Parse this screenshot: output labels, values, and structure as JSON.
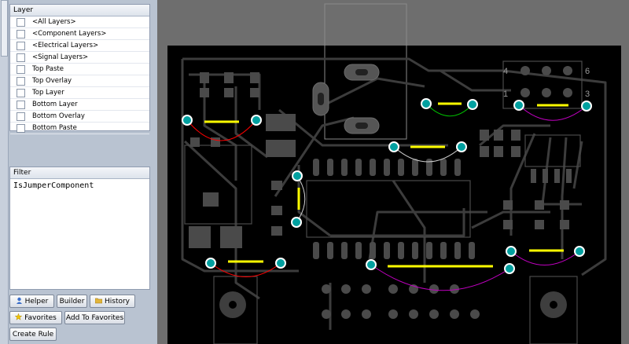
{
  "layer_panel": {
    "title": "Layer",
    "items": [
      {
        "label": "<All Layers>"
      },
      {
        "label": "<Component Layers>"
      },
      {
        "label": "<Electrical Layers>"
      },
      {
        "label": "<Signal Layers>"
      },
      {
        "label": "Top Paste"
      },
      {
        "label": "Top Overlay"
      },
      {
        "label": "Top Layer"
      },
      {
        "label": "Bottom Layer"
      },
      {
        "label": "Bottom Overlay"
      },
      {
        "label": "Bottom Paste"
      }
    ]
  },
  "filter_panel": {
    "title": "Filter",
    "query": "IsJumperComponent"
  },
  "buttons": {
    "helper": "Helper",
    "builder": "Builder",
    "history": "History",
    "favorites": "Favorites",
    "add_to_favorites": "Add To Favorites",
    "create_rule": "Create Rule"
  },
  "board": {
    "connector_labels": [
      "4",
      "6",
      "1",
      "3"
    ],
    "colors": {
      "board": "#000000",
      "trace": "#3c3c3c",
      "jumper": "#ffff00",
      "pad": "#00a0a0",
      "workspace": "#6e6e6e",
      "arc_red": "#ff0000",
      "arc_green": "#00c000",
      "arc_magenta": "#c000c0",
      "arc_white": "#d0d0d0"
    }
  }
}
